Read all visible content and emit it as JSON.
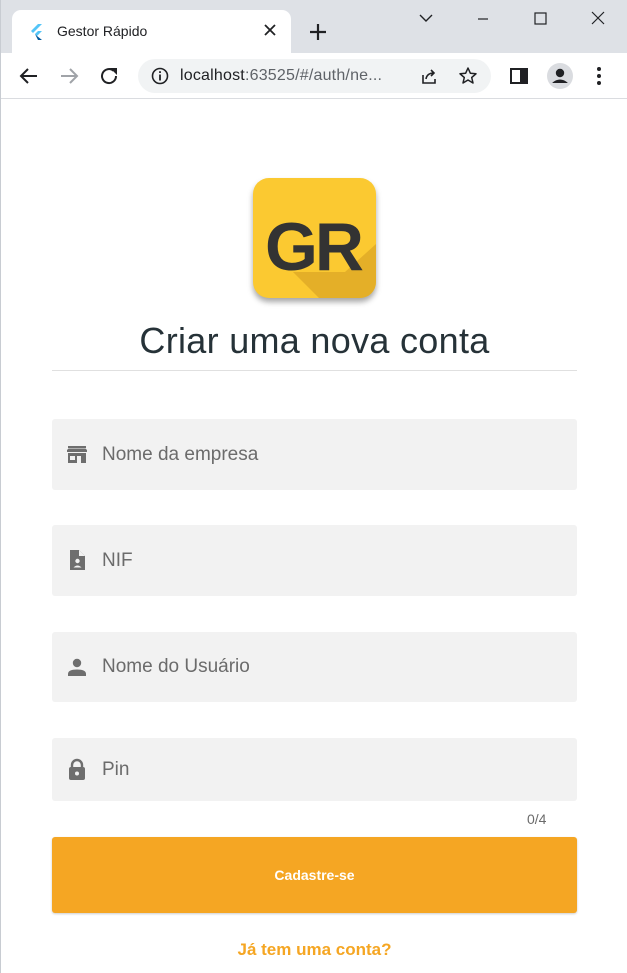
{
  "browser": {
    "tab": {
      "title": "Gestor Rápido",
      "favicon": "flutter-icon",
      "close_icon": "close-icon"
    },
    "new_tab_icon": "plus-icon",
    "window_controls": [
      "chevron-down-icon",
      "minimize-icon",
      "maximize-icon",
      "close-icon"
    ],
    "toolbar": {
      "back_icon": "back-arrow-icon",
      "forward_icon": "forward-arrow-icon",
      "reload_icon": "reload-icon",
      "site_info_icon": "info-icon",
      "url_host": "localhost",
      "url_rest": ":63525/#/auth/ne...",
      "share_icon": "share-icon",
      "bookmark_icon": "star-icon",
      "side_panel_icon": "side-panel-icon",
      "profile_icon": "profile-icon",
      "menu_icon": "kebab-menu-icon"
    }
  },
  "page": {
    "logo_text": "GR",
    "title": "Criar uma nova conta",
    "fields": {
      "company": {
        "placeholder": "Nome da empresa",
        "icon": "store-icon"
      },
      "nif": {
        "placeholder": "NIF",
        "icon": "contact-document-icon"
      },
      "username": {
        "placeholder": "Nome do Usuário",
        "icon": "person-icon"
      },
      "pin": {
        "placeholder": "Pin",
        "icon": "lock-icon",
        "counter": "0/4"
      }
    },
    "submit_label": "Cadastre-se",
    "login_link": "Já tem uma conta?"
  },
  "colors": {
    "accent": "#f5a623",
    "logo_background": "#fbc931",
    "title_text": "#263238",
    "field_background": "#f2f2f2"
  }
}
